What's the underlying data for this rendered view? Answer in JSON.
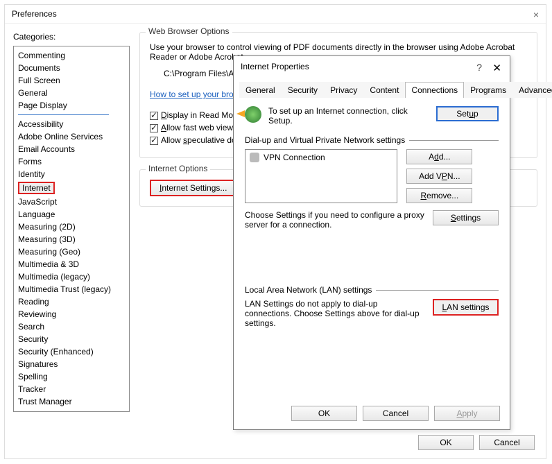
{
  "prefs": {
    "title": "Preferences",
    "categoriesLabel": "Categories:",
    "categories_top": [
      "Commenting",
      "Documents",
      "Full Screen",
      "General",
      "Page Display"
    ],
    "categories_rest": [
      "Accessibility",
      "Adobe Online Services",
      "Email Accounts",
      "Forms",
      "Identity",
      "Internet",
      "JavaScript",
      "Language",
      "Measuring (2D)",
      "Measuring (3D)",
      "Measuring (Geo)",
      "Multimedia & 3D",
      "Multimedia (legacy)",
      "Multimedia Trust (legacy)",
      "Reading",
      "Reviewing",
      "Search",
      "Security",
      "Security (Enhanced)",
      "Signatures",
      "Spelling",
      "Tracker",
      "Trust Manager"
    ],
    "selected": "Internet",
    "webGroup": "Web Browser Options",
    "webDesc": "Use your browser to control viewing of PDF documents directly in the browser using Adobe Acrobat Reader or Adobe Acrobat...",
    "path": "C:\\Program Files\\Ado",
    "howto": "How to set up your brow",
    "chk1": "Display in Read Mode",
    "chk2": "Allow fast web view",
    "chk3": "Allow speculative dow",
    "ioGroup": "Internet Options",
    "ioBtn": "Internet Settings...",
    "ok": "OK",
    "cancel": "Cancel"
  },
  "iprops": {
    "title": "Internet Properties",
    "tabs": [
      "General",
      "Security",
      "Privacy",
      "Content",
      "Connections",
      "Programs",
      "Advanced"
    ],
    "activeTab": "Connections",
    "setupText": "To set up an Internet connection, click Setup.",
    "setupBtn": "Setup",
    "dialupLabel": "Dial-up and Virtual Private Network settings",
    "vpnItem": "VPN Connection",
    "addBtn": "Add...",
    "addVpnBtn": "Add VPN...",
    "removeBtn": "Remove...",
    "settingsBtn": "Settings",
    "proxyText": "Choose Settings if you need to configure a proxy server for a connection.",
    "lanLabel": "Local Area Network (LAN) settings",
    "lanText": "LAN Settings do not apply to dial-up connections. Choose Settings above for dial-up settings.",
    "lanBtn": "LAN settings",
    "ok": "OK",
    "cancel": "Cancel",
    "apply": "Apply"
  }
}
